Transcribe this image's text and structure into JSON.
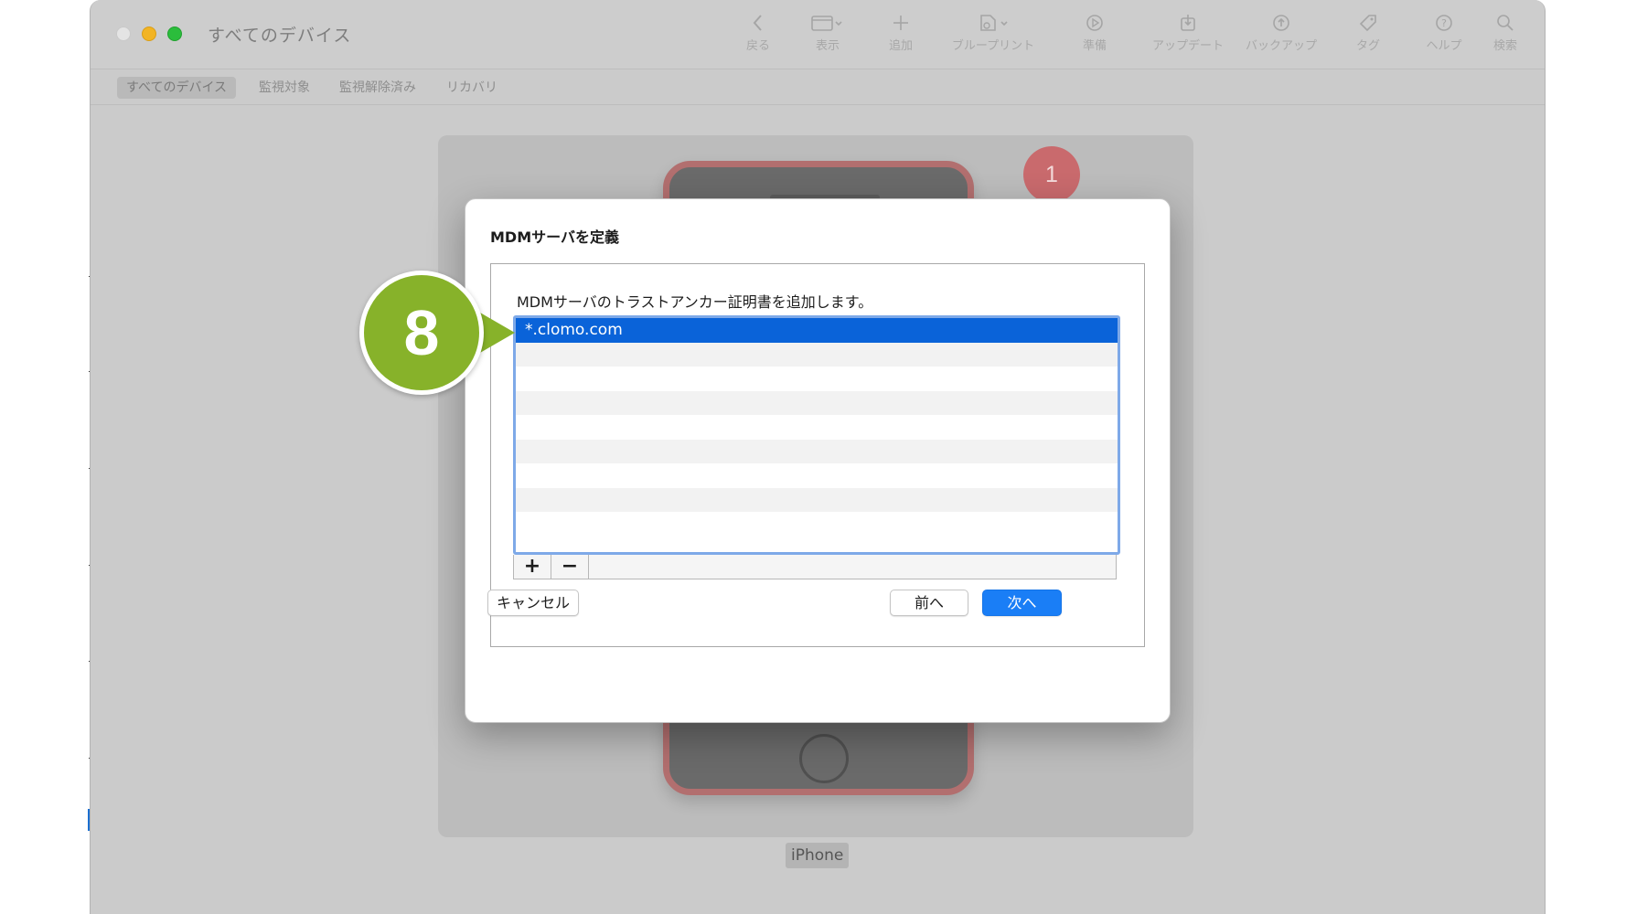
{
  "window": {
    "title": "すべてのデバイス"
  },
  "toolbar": {
    "items": [
      {
        "label": "戻る",
        "icon": "chevron-left-icon"
      },
      {
        "label": "表示",
        "icon": "view-icon"
      },
      {
        "label": "追加",
        "icon": "plus-icon"
      },
      {
        "label": "ブループリント",
        "icon": "blueprint-icon"
      },
      {
        "label": "準備",
        "icon": "prepare-icon"
      },
      {
        "label": "アップデート",
        "icon": "update-icon"
      },
      {
        "label": "バックアップ",
        "icon": "backup-icon"
      },
      {
        "label": "タグ",
        "icon": "tag-icon"
      },
      {
        "label": "ヘルプ",
        "icon": "help-icon"
      },
      {
        "label": "検索",
        "icon": "search-icon"
      }
    ]
  },
  "scope_bar": {
    "items": [
      "すべてのデバイス",
      "監視対象",
      "監視解除済み",
      "リカバリ"
    ],
    "active": "すべてのデバイス"
  },
  "device": {
    "label": "iPhone",
    "badge_count": "1"
  },
  "dialog": {
    "title": "MDMサーバを定義",
    "description": "MDMサーバのトラストアンカー証明書を追加します。",
    "certificates": [
      "*.clomo.com"
    ],
    "add_button": "+",
    "remove_button": "−",
    "cancel_button": "キャンセル",
    "back_button": "前へ",
    "next_button": "次へ"
  },
  "annotation": {
    "step_number": "8",
    "color": "#87b22a"
  }
}
